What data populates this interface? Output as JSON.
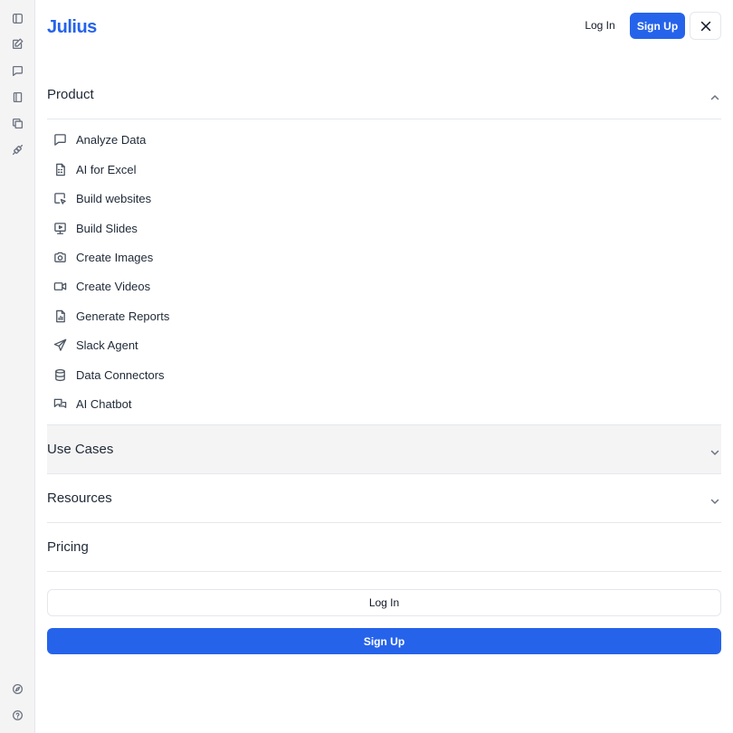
{
  "brand": {
    "name": "Julius",
    "accent_color": "#2563eb"
  },
  "rail": {
    "top_icons": [
      "sidebar-toggle-icon",
      "new-chat-icon",
      "chat-icon",
      "notebook-icon",
      "files-icon",
      "connections-icon"
    ],
    "bottom_icons": [
      "explore-icon",
      "help-icon"
    ]
  },
  "header": {
    "login_label": "Log In",
    "signup_label": "Sign Up",
    "close_icon": "close-icon"
  },
  "nav": {
    "product": {
      "label": "Product",
      "expanded": true,
      "items": [
        {
          "label": "Analyze Data",
          "icon": "message-square-icon"
        },
        {
          "label": "AI for Excel",
          "icon": "spreadsheet-icon"
        },
        {
          "label": "Build websites",
          "icon": "cursor-window-icon"
        },
        {
          "label": "Build Slides",
          "icon": "presentation-icon"
        },
        {
          "label": "Create Images",
          "icon": "camera-icon"
        },
        {
          "label": "Create Videos",
          "icon": "video-icon"
        },
        {
          "label": "Generate Reports",
          "icon": "report-icon"
        },
        {
          "label": "Slack Agent",
          "icon": "send-icon"
        },
        {
          "label": "Data Connectors",
          "icon": "database-icon"
        },
        {
          "label": "AI Chatbot",
          "icon": "chat-bubbles-icon"
        }
      ]
    },
    "use_cases": {
      "label": "Use Cases",
      "expanded": false
    },
    "resources": {
      "label": "Resources",
      "expanded": false
    },
    "pricing": {
      "label": "Pricing"
    }
  },
  "footer": {
    "login_label": "Log In",
    "signup_label": "Sign Up"
  }
}
